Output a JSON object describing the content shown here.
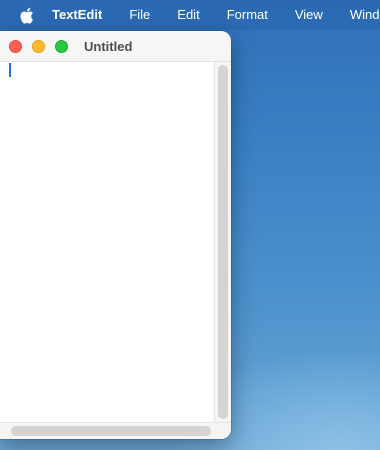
{
  "menubar": {
    "apple_icon": "apple-icon",
    "app_name": "TextEdit",
    "items": [
      "File",
      "Edit",
      "Format",
      "View",
      "Window"
    ]
  },
  "window": {
    "title": "Untitled",
    "document_text": ""
  },
  "colors": {
    "close": "#fe5f57",
    "minimize": "#febc2e",
    "zoom": "#28c840",
    "caret": "#1f6fe0"
  }
}
